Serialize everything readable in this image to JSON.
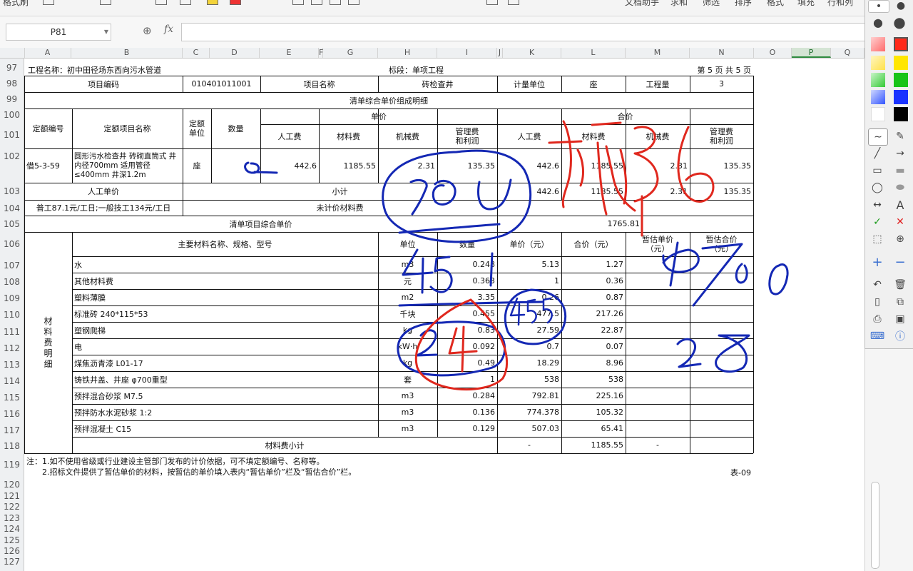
{
  "ribbon": {
    "labels": [
      "格式刷",
      "文档助手",
      "求和",
      "筛选",
      "排序",
      "格式",
      "填充",
      "行和列"
    ]
  },
  "formula_bar": {
    "name_box": "P81",
    "fx": "fx",
    "value": ""
  },
  "columns": [
    "A",
    "B",
    "C",
    "D",
    "E",
    "F",
    "G",
    "H",
    "I",
    "J",
    "K",
    "L",
    "M",
    "N",
    "O",
    "P",
    "Q"
  ],
  "selected_column": "P",
  "rows": [
    "97",
    "98",
    "99",
    "100",
    "101",
    "102",
    "103",
    "104",
    "105",
    "106",
    "107",
    "108",
    "109",
    "110",
    "111",
    "112",
    "113",
    "114",
    "115",
    "116",
    "117",
    "118",
    "119",
    "120",
    "121",
    "122",
    "123",
    "124",
    "125",
    "126",
    "127"
  ],
  "sheet": {
    "header_project": "工程名称：初中田径场东西向污水管道",
    "header_section": "标段：单项工程",
    "header_page": "第 5 页  共 5 页",
    "r98": {
      "code_label": "项目编码",
      "code": "010401011001",
      "name_label": "项目名称",
      "name": "砖检查井",
      "unit_label": "计量单位",
      "unit": "座",
      "qty_label": "工程量",
      "qty": "3"
    },
    "r99_title": "清单综合单价组成明细",
    "head": {
      "quota_no": "定额编号",
      "quota_name": "定额项目名称",
      "quota_unit": "定额\n单位",
      "quantity": "数量",
      "unit_price": "单价",
      "total_price": "合价",
      "labor": "人工费",
      "material": "材料费",
      "machine": "机械费",
      "mgmt": "管理费\n和利润"
    },
    "r102": {
      "no": "借5-3-59",
      "name": "圆形污水检查井 砖砌直筒式 井内径700mm 适用管径≤400mm 井深1.2m",
      "unit": "座",
      "qty": "",
      "labor": "442.6",
      "material": "1185.55",
      "machine": "2.31",
      "mgmt": "135.35",
      "t_labor": "442.6",
      "t_material": "1185.55",
      "t_machine": "2.31",
      "t_mgmt": "135.35"
    },
    "r103": {
      "label": "人工单价",
      "subtotal": "小计",
      "t_labor": "442.6",
      "t_material": "1185.55",
      "t_machine": "2.31",
      "t_mgmt": "135.35"
    },
    "r104": {
      "labor_rate": "普工87.1元/工日;一般技工134元/工日",
      "unpriced": "未计价材料费"
    },
    "r105": {
      "label": "清单项目综合单价",
      "value": "1765.81"
    },
    "mat_head": {
      "side": "材\n料\n费\n明\n细",
      "name": "主要材料名称、规格、型号",
      "unit": "单位",
      "qty": "数量",
      "price": "单价（元）",
      "total": "合价（元）",
      "est_price": "暂估单价\n（元）",
      "est_total": "暂估合价\n（元）"
    },
    "materials": [
      {
        "name": "水",
        "unit": "m3",
        "qty": "0.248",
        "price": "5.13",
        "total": "1.27"
      },
      {
        "name": "其他材料费",
        "unit": "元",
        "qty": "0.363",
        "price": "1",
        "total": "0.36"
      },
      {
        "name": "塑料薄膜",
        "unit": "m2",
        "qty": "3.35",
        "price": "0.26",
        "total": "0.87"
      },
      {
        "name": "标准砖 240*115*53",
        "unit": "千块",
        "qty": "0.455",
        "price": "477.5",
        "total": "217.26"
      },
      {
        "name": "塑钢爬梯",
        "unit": "kg",
        "qty": "0.83",
        "price": "27.59",
        "total": "22.87"
      },
      {
        "name": "电",
        "unit": "kW·h",
        "qty": "0.092",
        "price": "0.7",
        "total": "0.07"
      },
      {
        "name": "煤焦沥青漆 L01-17",
        "unit": "kg",
        "qty": "0.49",
        "price": "18.29",
        "total": "8.96"
      },
      {
        "name": "铸铁井盖、井座 φ700重型",
        "unit": "套",
        "qty": "1",
        "price": "538",
        "total": "538"
      },
      {
        "name": "预拌混合砂浆 M7.5",
        "unit": "m3",
        "qty": "0.284",
        "price": "792.81",
        "total": "225.16"
      },
      {
        "name": "预拌防水水泥砂浆 1:2",
        "unit": "m3",
        "qty": "0.136",
        "price": "774.378",
        "total": "105.32"
      },
      {
        "name": "预拌混凝土 C15",
        "unit": "m3",
        "qty": "0.129",
        "price": "507.03",
        "total": "65.41"
      }
    ],
    "r118": {
      "label": "材料费小计",
      "price": "-",
      "total": "1185.55",
      "est": "-"
    },
    "note1": "注：1.如不使用省级或行业建设主管部门发布的计价依据，可不填定额编号、名称等。",
    "note2": "2.招标文件提供了暂估单价的材料，按暂估的单价填入表内“暂估单价”栏及“暂估合价”栏。",
    "table_no": "表-09"
  },
  "annotations": {
    "blue_zero": "0",
    "blue_700": "700",
    "blue_451": "451",
    "blue_455": "455",
    "blue_24": "24",
    "blue_phi700": "φ700",
    "blue_28": "28",
    "red_text": "砌筑",
    "red_6": "6",
    "red_4": "4"
  },
  "colors": {
    "accent": "#2e8b3e",
    "annot_blue": "#1428b4",
    "annot_red": "#e0281e",
    "grid": "#111111"
  }
}
